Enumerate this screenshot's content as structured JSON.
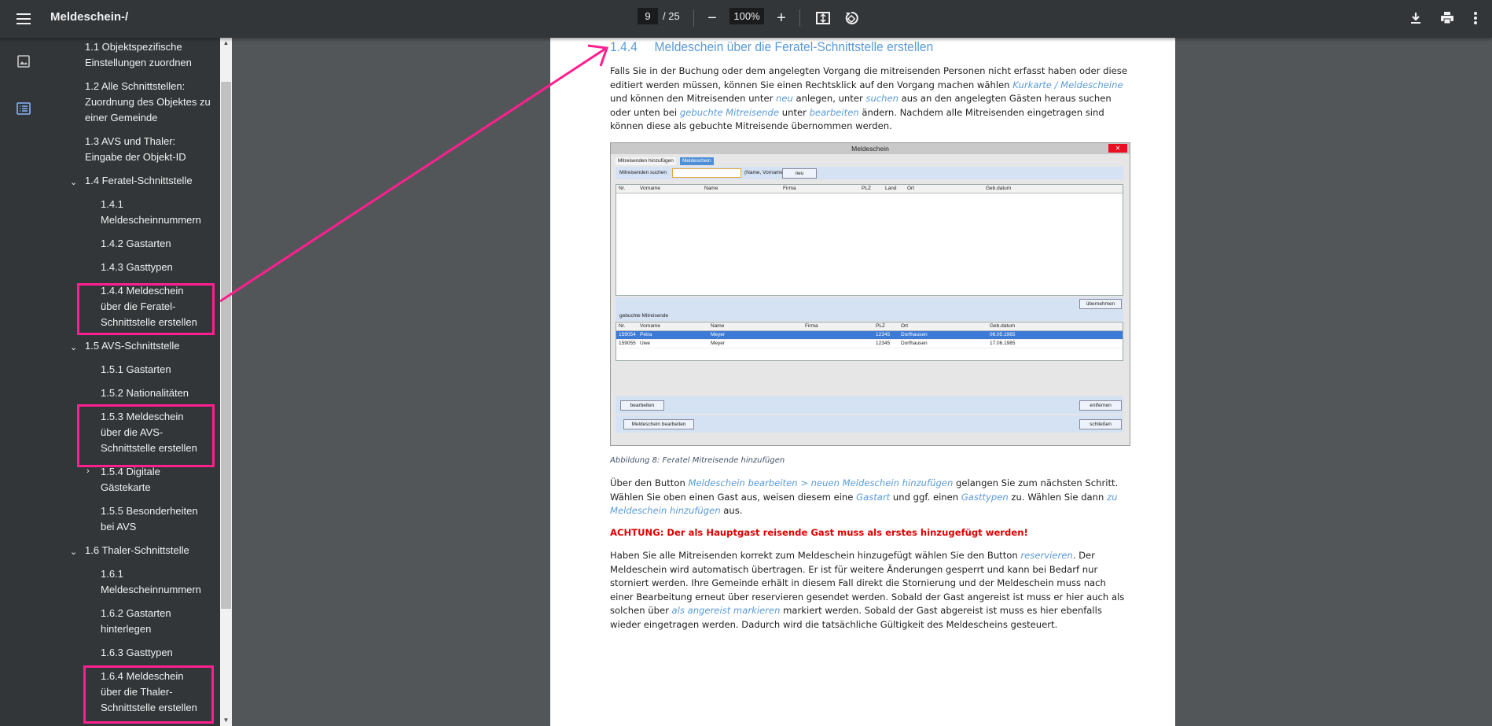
{
  "toolbar": {
    "title": "Meldeschein-/",
    "page_current": "9",
    "page_total": "/ 25",
    "zoom": "100%"
  },
  "outline": [
    {
      "label": "1.1 Objektspezifische Einstellungen zuordnen"
    },
    {
      "label": "1.2 Alle Schnittstellen: Zuordnung des Objektes zu einer Gemeinde"
    },
    {
      "label": "1.3 AVS und Thaler: Eingabe der Objekt-ID"
    },
    {
      "label": "1.4 Feratel-Schnittstelle"
    },
    {
      "label": "1.4.1 Meldescheinnummern"
    },
    {
      "label": "1.4.2 Gastarten"
    },
    {
      "label": "1.4.3 Gasttypen"
    },
    {
      "label": "1.4.4 Meldeschein über die Feratel-Schnittstelle erstellen"
    },
    {
      "label": "1.5 AVS-Schnittstelle"
    },
    {
      "label": "1.5.1 Gastarten"
    },
    {
      "label": "1.5.2 Nationalitäten"
    },
    {
      "label": "1.5.3 Meldeschein über die AVS-Schnittstelle erstellen"
    },
    {
      "label": "1.5.4 Digitale Gästekarte"
    },
    {
      "label": "1.5.5 Besonderheiten bei AVS"
    },
    {
      "label": "1.6 Thaler-Schnittstelle"
    },
    {
      "label": "1.6.1 Meldescheinnummern"
    },
    {
      "label": "1.6.2 Gastarten hinterlegen"
    },
    {
      "label": "1.6.3 Gasttypen"
    },
    {
      "label": "1.6.4 Meldeschein über die Thaler-Schnittstelle erstellen"
    }
  ],
  "doc": {
    "heading_num": "1.4.4",
    "heading_text": "Meldeschein über die Feratel-Schnittstelle erstellen",
    "p1": {
      "t1": "Falls Sie in der Buchung oder dem angelegten Vorgang die mitreisenden Personen nicht erfasst haben oder diese editiert werden müssen, können Sie einen Rechtsklick auf den Vorgang machen wählen ",
      "l1": "Kurkarte / Meldescheine",
      "t2": " und können den Mitreisenden unter ",
      "l2": "neu",
      "t3": " anlegen, unter ",
      "l3": "suchen",
      "t4": " aus an den angelegten Gästen heraus suchen oder unten bei ",
      "l4": "gebuchte Mitreisende",
      "t5": " unter ",
      "l5": "bearbeiten",
      "t6": " ändern. Nachdem alle Mitreisenden eingetragen sind können diese als gebuchte Mitreisende übernommen werden."
    },
    "caption": "Abbildung 8: Feratel Mitreisende hinzufügen",
    "p2": {
      "t1": "Über den Button ",
      "l1": "Meldeschein bearbeiten > neuen Meldeschein hinzufügen",
      "t2": " gelangen Sie zum nächsten Schritt. Wählen Sie oben einen Gast aus, weisen diesem eine ",
      "l2": "Gastart",
      "t3": " und ggf. einen ",
      "l3": "Gasttypen",
      "t4": " zu. Wählen Sie dann ",
      "l4": "zu Meldeschein hinzufügen",
      "t5": " aus."
    },
    "warning": "ACHTUNG: Der als Hauptgast reisende Gast muss als erstes hinzugefügt werden!",
    "p3": {
      "t1": "Haben Sie alle Mitreisenden korrekt zum Meldeschein hinzugefügt wählen Sie den Button ",
      "l1": "reservieren",
      "t2": ". Der Meldeschein wird automatisch übertragen. Er ist für weitere Änderungen gesperrt und kann bei Bedarf nur storniert werden. Ihre Gemeinde erhält in diesem Fall direkt die Stornierung und der Meldeschein muss nach einer Bearbeitung erneut über reservieren gesendet werden. Sobald der Gast angereist ist muss er hier auch als solchen über ",
      "l2": "als angereist markieren",
      "t3": " markiert werden. Sobald der Gast abgereist ist muss es hier ebenfalls wieder eingetragen werden. Dadurch wird die tatsächliche Gültigkeit des Meldescheins gesteuert."
    }
  },
  "screenshot": {
    "title": "Meldeschein",
    "tabs": [
      "Mitreisenden hinzufügen",
      "Meldeschein"
    ],
    "search_label": "Mitreisenden suchen",
    "search_hint": "(Name, Vorname)",
    "neu_btn": "neu",
    "top_columns": [
      "Nr.",
      "Vorname",
      "Name",
      "Firma",
      "PLZ",
      "Land",
      "Ort",
      "Geb.datum"
    ],
    "uebernehmen_btn": "übernehmen",
    "booked_label": "gebuchte Mitreisende",
    "bottom_columns": [
      "Nr.",
      "Vorname",
      "Name",
      "Firma",
      "PLZ",
      "Ort",
      "Geb.datum"
    ],
    "rows": [
      [
        "159054",
        "Petra",
        "Meyer",
        "",
        "12345",
        "Dorfhausen",
        "06.05.1965"
      ],
      [
        "159055",
        "Uwe",
        "Meyer",
        "",
        "12345",
        "Dorfhausen",
        "17.06.1985"
      ]
    ],
    "bearbeiten_btn": "bearbeiten",
    "entfernen_btn": "entfernen",
    "meldeschein_btn": "Meldeschein bearbeiten",
    "schliessen_btn": "schließen"
  },
  "colors": {
    "highlight": "#ff1f8e",
    "link": "#5b9bd5",
    "warning": "#e00000"
  }
}
